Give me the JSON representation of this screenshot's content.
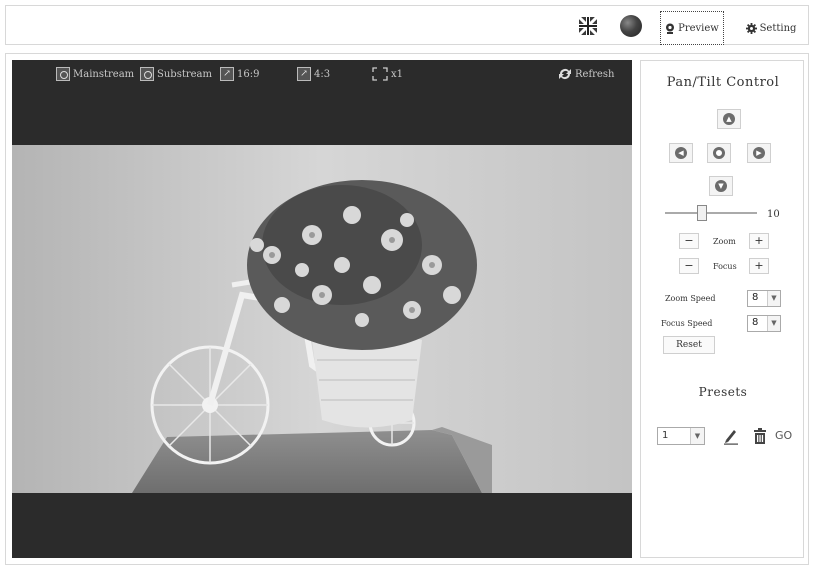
{
  "topbar": {
    "preview_label": "Preview",
    "setting_label": "Setting"
  },
  "video_toolbar": {
    "mainstream": "Mainstream",
    "substream": "Substream",
    "ratio_16_9": "16:9",
    "ratio_4_3": "4:3",
    "zoom_x1": "x1",
    "refresh": "Refresh"
  },
  "ptz": {
    "title": "Pan/Tilt Control",
    "speed_value": "10",
    "zoom_label": "Zoom",
    "focus_label": "Focus",
    "minus": "−",
    "plus": "+",
    "zoom_speed_label": "Zoom Speed",
    "zoom_speed_value": "8",
    "focus_speed_label": "Focus Speed",
    "focus_speed_value": "8",
    "reset_label": "Reset"
  },
  "presets": {
    "title": "Presets",
    "selected": "1",
    "go_label": "GO"
  },
  "slider": {
    "value": 10
  },
  "colors": {
    "video_bg": "#2b2b2b",
    "panel_border": "#d8d8d8",
    "button_gray": "#6b6b6b"
  }
}
